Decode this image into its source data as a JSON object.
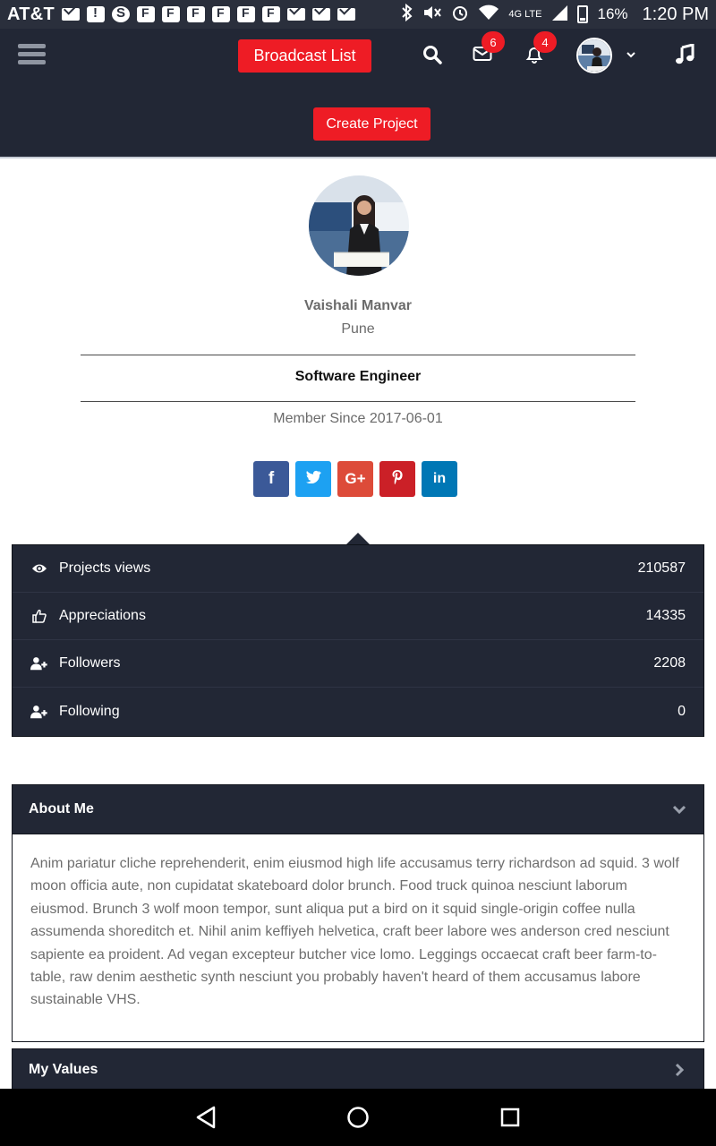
{
  "status_bar": {
    "carrier": "AT&T",
    "battery": "16%",
    "time": "1:20 PM",
    "network": "4G LTE"
  },
  "header": {
    "broadcast_label": "Broadcast List",
    "mail_count": "6",
    "notification_count": "4",
    "create_label": "Create Project"
  },
  "profile": {
    "name": "Vaishali Manvar",
    "city": "Pune",
    "role": "Software Engineer",
    "member_since": "Member Since 2017-06-01"
  },
  "social": [
    {
      "name": "facebook",
      "glyph": "f",
      "color": "#3b5998"
    },
    {
      "name": "twitter",
      "glyph": "twitter-bird",
      "color": "#1da1f2"
    },
    {
      "name": "google-plus",
      "glyph": "G+",
      "color": "#dd4b39"
    },
    {
      "name": "pinterest",
      "glyph": "P",
      "color": "#cb2027"
    },
    {
      "name": "linkedin",
      "glyph": "in",
      "color": "#0077b5"
    }
  ],
  "stats": [
    {
      "label": "Projects views",
      "value": "210587",
      "icon": "eye-icon"
    },
    {
      "label": "Appreciations",
      "value": "14335",
      "icon": "thumbs-up-icon"
    },
    {
      "label": "Followers",
      "value": "2208",
      "icon": "user-plus-icon"
    },
    {
      "label": "Following",
      "value": "0",
      "icon": "user-plus-icon"
    }
  ],
  "about": {
    "title": "About Me",
    "body": "Anim pariatur cliche reprehenderit, enim eiusmod high life accusamus terry richardson ad squid. 3 wolf moon officia aute, non cupidatat skateboard dolor brunch. Food truck quinoa nesciunt laborum eiusmod. Brunch 3 wolf moon tempor, sunt aliqua put a bird on it squid single-origin coffee nulla assumenda shoreditch et. Nihil anim keffiyeh helvetica, craft beer labore wes anderson cred nesciunt sapiente ea proident. Ad vegan excepteur butcher vice lomo. Leggings occaecat craft beer farm-to-table, raw denim aesthetic synth nesciunt you probably haven't heard of them accusamus labore sustainable VHS."
  },
  "values_panel": {
    "title": "My Values"
  },
  "colors": {
    "header_bg": "#222735",
    "accent_red": "#ee1c25",
    "status_bar_bg": "#2a2f3c"
  }
}
